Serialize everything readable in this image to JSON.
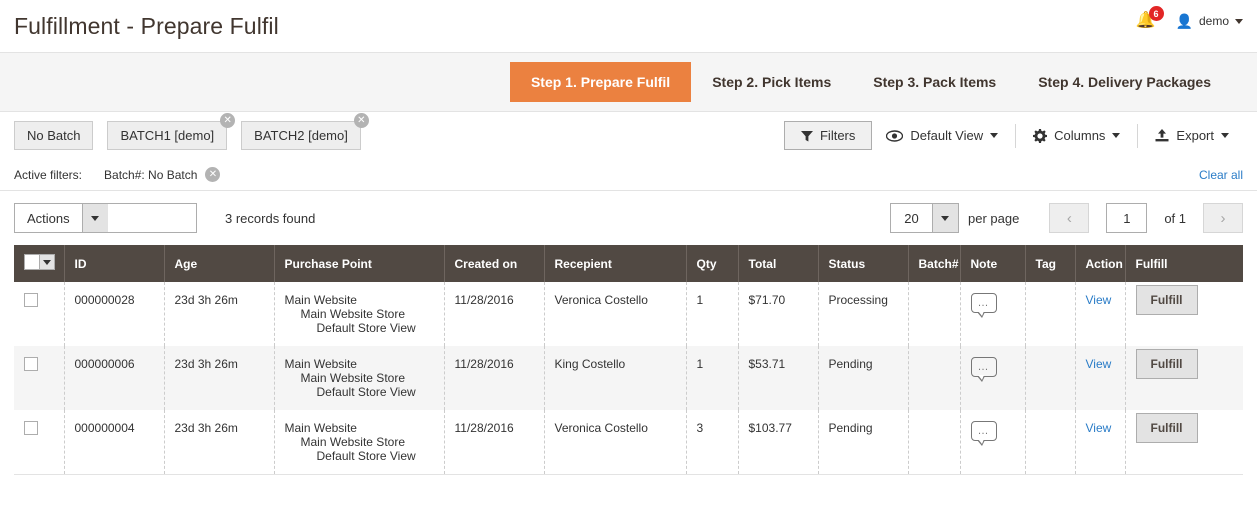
{
  "header": {
    "title": "Fulfillment - Prepare Fulfil",
    "notification_count": "6",
    "user_name": "demo",
    "bell_icon": "bell-icon",
    "user_icon": "user-icon"
  },
  "tabs": [
    {
      "label": "Step 1. Prepare Fulfil",
      "active": true
    },
    {
      "label": "Step 2. Pick Items",
      "active": false
    },
    {
      "label": "Step 3. Pack Items",
      "active": false
    },
    {
      "label": "Step 4. Delivery Packages",
      "active": false
    }
  ],
  "accent_color": "#eb8140",
  "batch_buttons": [
    {
      "label": "No Batch",
      "closable": false
    },
    {
      "label": "BATCH1 [demo]",
      "closable": true
    },
    {
      "label": "BATCH2 [demo]",
      "closable": true
    }
  ],
  "toolbar": {
    "filters_label": "Filters",
    "filters_icon": "funnel-icon",
    "view_label": "Default View",
    "view_icon": "eye-icon",
    "columns_label": "Columns",
    "columns_icon": "gear-icon",
    "export_label": "Export",
    "export_icon": "export-upload-icon"
  },
  "active_filters": {
    "label": "Active filters:",
    "chips": [
      {
        "text": "Batch#: No Batch"
      }
    ],
    "clear_all_label": "Clear all"
  },
  "actions_bar": {
    "actions_label": "Actions",
    "records_found": "3 records found",
    "per_page_value": "20",
    "per_page_label": "per page",
    "page_value": "1",
    "of_label": "of 1",
    "prev_icon": "chevron-left-icon",
    "next_icon": "chevron-right-icon"
  },
  "table": {
    "columns": [
      "ID",
      "Age",
      "Purchase Point",
      "Created on",
      "Recepient",
      "Qty",
      "Total",
      "Status",
      "Batch#",
      "Note",
      "Tag",
      "Action",
      "Fulfill"
    ],
    "rows": [
      {
        "id": "000000028",
        "age": "23d 3h 26m",
        "purchase_point": [
          "Main Website",
          "Main Website Store",
          "Default Store View"
        ],
        "created_on": "11/28/2016",
        "recepient": "Veronica Costello",
        "qty": "1",
        "total": "$71.70",
        "status": "Processing",
        "batch": "",
        "note_icon": "note-bubble-icon",
        "tag": "",
        "action": "View",
        "fulfill": "Fulfill"
      },
      {
        "id": "000000006",
        "age": "23d 3h 26m",
        "purchase_point": [
          "Main Website",
          "Main Website Store",
          "Default Store View"
        ],
        "created_on": "11/28/2016",
        "recepient": "King Costello",
        "qty": "1",
        "total": "$53.71",
        "status": "Pending",
        "batch": "",
        "note_icon": "note-bubble-icon",
        "tag": "",
        "action": "View",
        "fulfill": "Fulfill"
      },
      {
        "id": "000000004",
        "age": "23d 3h 26m",
        "purchase_point": [
          "Main Website",
          "Main Website Store",
          "Default Store View"
        ],
        "created_on": "11/28/2016",
        "recepient": "Veronica Costello",
        "qty": "3",
        "total": "$103.77",
        "status": "Pending",
        "batch": "",
        "note_icon": "note-bubble-icon",
        "tag": "",
        "action": "View",
        "fulfill": "Fulfill"
      }
    ]
  }
}
